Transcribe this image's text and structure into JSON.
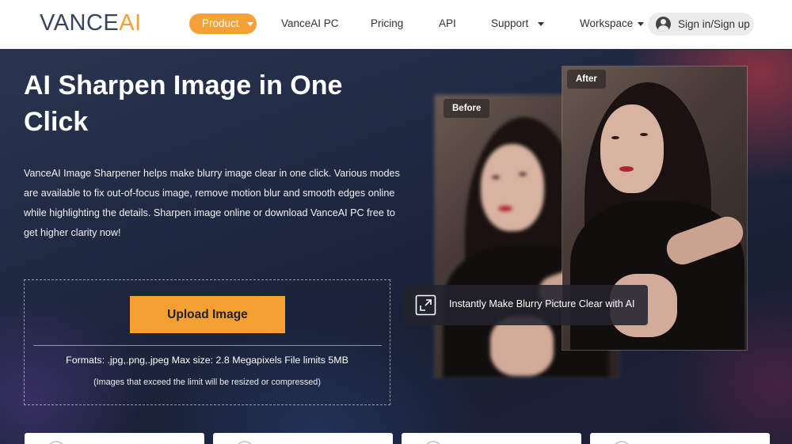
{
  "nav": {
    "logo_main": "VANCE",
    "logo_accent": "AI",
    "product": "Product",
    "vanceai_pc": "VanceAI PC",
    "pricing": "Pricing",
    "api": "API",
    "support": "Support",
    "workspace": "Workspace",
    "signin": "Sign in/Sign up"
  },
  "hero": {
    "title": "AI Sharpen Image in One Click",
    "description": "VanceAI Image Sharpener helps make blurry image clear in one click. Various modes are available to fix out-of-focus image, remove motion blur and smooth edges online while highlighting the details. Sharpen image online or download VanceAI PC free to get higher clarity now!",
    "upload_button": "Upload Image",
    "formats": "Formats: .jpg,.png,.jpeg Max size: 2.8 Megapixels File limits 5MB",
    "limit_note": "(Images that exceed the limit will be resized or compressed)"
  },
  "compare": {
    "before_label": "Before",
    "after_label": "After",
    "caption": "Instantly Make Blurry Picture Clear with AI"
  },
  "colors": {
    "accent": "#f5a033",
    "logo": "#37445e"
  }
}
